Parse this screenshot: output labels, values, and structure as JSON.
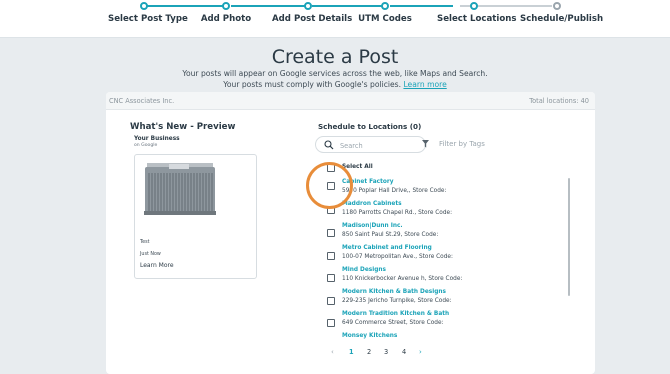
{
  "stepper": {
    "steps": [
      {
        "label": "Select Post Type",
        "state": "done"
      },
      {
        "label": "Add Photo",
        "state": "done"
      },
      {
        "label": "Add Post Details",
        "state": "done"
      },
      {
        "label": "UTM Codes",
        "state": "done"
      },
      {
        "label": "Select Locations",
        "state": "current"
      },
      {
        "label": "Schedule/Publish",
        "state": "pending"
      }
    ]
  },
  "header": {
    "title": "Create a Post",
    "subtitle": "Your posts will appear on Google services across the web, like Maps and Search.",
    "policy_text": "Your posts must comply with Google's policies.",
    "policy_link": "Learn more"
  },
  "panel": {
    "org_name": "CNC Associates Inc.",
    "total_locations": "Total locations: 40"
  },
  "preview": {
    "title": "What's New - Preview",
    "business_name": "Your Business",
    "business_sub": "on Google",
    "body_text": "Test",
    "time_text": "Just Now",
    "cta": "Learn More"
  },
  "locations": {
    "title": "Schedule to Locations (0)",
    "search_placeholder": "Search",
    "filter_placeholder": "Filter by Tags",
    "select_all": "Select All",
    "items": [
      {
        "name": "Cabinet Factory",
        "address": "5950 Poplar Hall Drive,, Store Code:"
      },
      {
        "name": "Maddron Cabinets",
        "address": "1180 Parrotts Chapel Rd., Store Code:"
      },
      {
        "name": "Madison|Dunn Inc.",
        "address": "850 Saint Paul St.29, Store Code:"
      },
      {
        "name": "Metro Cabinet and Flooring",
        "address": "100-07 Metropolitan Ave., Store Code:"
      },
      {
        "name": "Mind Designs",
        "address": "110 Knickerbocker Avenue h, Store Code:"
      },
      {
        "name": "Modern Kitchen & Bath Designs",
        "address": "229-235 Jericho Turnpike, Store Code:"
      },
      {
        "name": "Modern Tradition Kitchen & Bath",
        "address": "649 Commerce Street, Store Code:"
      },
      {
        "name": "Monsey Kitchens",
        "address": ""
      }
    ]
  },
  "pagination": {
    "pages": [
      "1",
      "2",
      "3",
      "4"
    ],
    "current": "1",
    "prev": "‹",
    "next": "›"
  },
  "colors": {
    "accent": "#1ba3b8",
    "highlight": "#e88d3a"
  }
}
